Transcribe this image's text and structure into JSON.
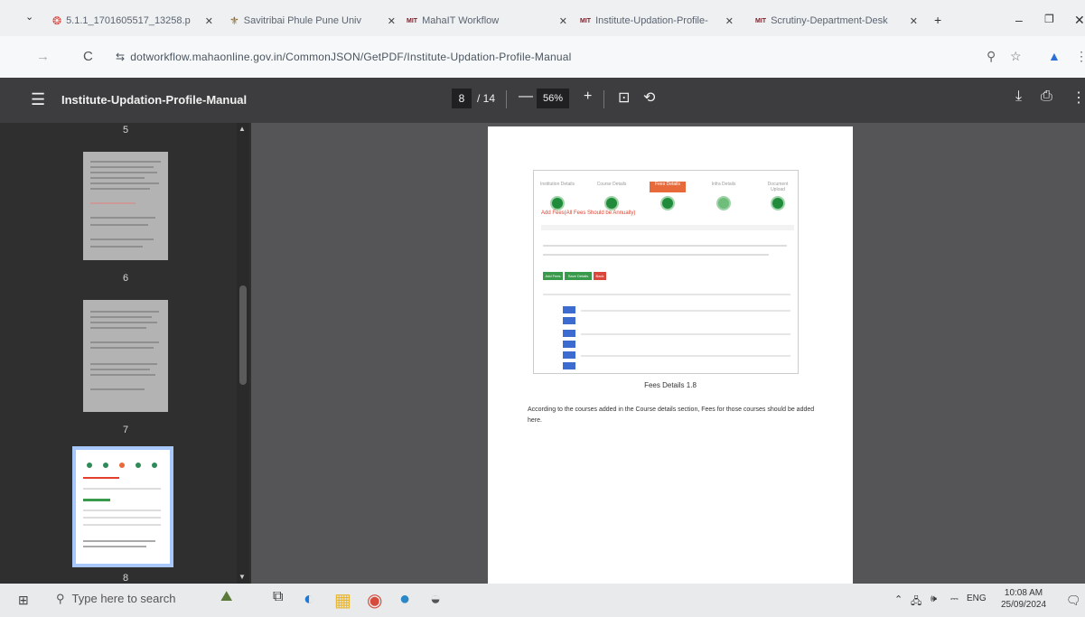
{
  "browser": {
    "tabs": [
      {
        "label": "5.1.1_1701605517_13258.p",
        "icon": "pdf-icon"
      },
      {
        "label": "Savitribai Phule Pune Univ",
        "icon": "university-icon"
      },
      {
        "label": "MahaIT Workflow",
        "icon": "mahait-icon"
      },
      {
        "label": "Institute-Updation-Profile-",
        "icon": "mahait-icon"
      },
      {
        "label": "Scrutiny-Department-Desk",
        "icon": "mahait-icon"
      }
    ],
    "url_prefix": "⇆",
    "url": "dotworkflow.mahaonline.gov.in/CommonJSON/GetPDF/Institute-Updation-Profile-Manual"
  },
  "pdf": {
    "title": "Institute-Updation-Profile-Manual",
    "current_page": "8",
    "total_pages": "/ 14",
    "zoom": "56%"
  },
  "thumbnails": {
    "labels": [
      "5",
      "6",
      "7",
      "8"
    ],
    "selected": "8"
  },
  "document": {
    "figure_steps": [
      "Institution Details",
      "Course Details",
      "Fees Details",
      "Infra Details",
      "Document Upload"
    ],
    "figure_warning": "Add Fees(All Fees Should be Annually)",
    "figure_buttons": [
      "Add Fees",
      "Save Details",
      "Back"
    ],
    "caption": "Fees Details 1.8",
    "paragraph": "According to the courses added in the Course details section, Fees for those courses should be added here."
  },
  "taskbar": {
    "search_placeholder": "Type here to search",
    "language": "ENG",
    "time": "10:08 AM",
    "date": "25/09/2024"
  },
  "colors": {
    "pdf_toolbar": "#3d3d3f",
    "viewer_bg": "#555558",
    "selected_thumb_outline": "#a8c7fa",
    "step_green": "#1f8b3b",
    "warning_red": "#e2402c"
  }
}
